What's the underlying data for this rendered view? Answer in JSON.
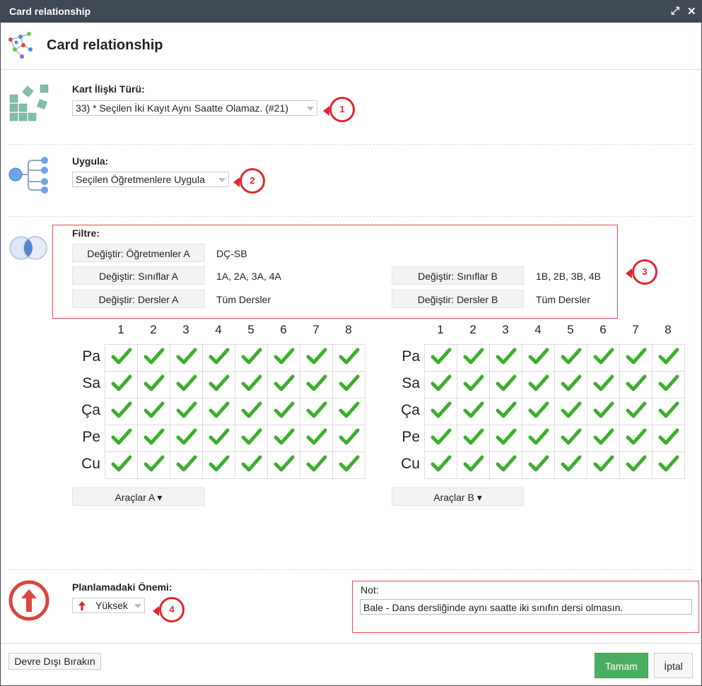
{
  "window": {
    "title": "Card relationship"
  },
  "header": {
    "title": "Card relationship"
  },
  "relation": {
    "label": "Kart İlişki Türü:",
    "value": "33) * Seçilen İki Kayıt Aynı Saatte Olamaz. (#21)",
    "badge": "1"
  },
  "apply": {
    "label": "Uygula:",
    "value": "Seçilen Öğretmenlere Uygula",
    "badge": "2"
  },
  "filter": {
    "label": "Filtre:",
    "badge": "3",
    "teachers_a_btn": "Değiştir: Öğretmenler A",
    "teachers_a_val": "DÇ-SB",
    "classes_a_btn": "Değiştir: Sınıflar A",
    "classes_a_val": "1A, 2A, 3A, 4A",
    "classes_b_btn": "Değiştir: Sınıflar B",
    "classes_b_val": "1B, 2B, 3B, 4B",
    "lessons_a_btn": "Değiştir: Dersler A",
    "lessons_a_val": "Tüm Dersler",
    "lessons_b_btn": "Değiştir: Dersler B",
    "lessons_b_val": "Tüm Dersler"
  },
  "grid": {
    "periods": [
      "1",
      "2",
      "3",
      "4",
      "5",
      "6",
      "7",
      "8"
    ],
    "days": [
      "Pa",
      "Sa",
      "Ça",
      "Pe",
      "Cu"
    ],
    "check_color": "#3cae2c"
  },
  "tools": {
    "a_label": "Araçlar A ▾",
    "b_label": "Araçlar B ▾"
  },
  "importance": {
    "label": "Planlamadaki Önemi:",
    "value": "Yüksek",
    "badge": "4"
  },
  "note": {
    "label": "Not:",
    "value": "Bale - Dans dersliğinde aynı saatte iki sınıfın dersi olmasın."
  },
  "footer": {
    "disable_label": "Devre Dışı Bırakın",
    "ok_label": "Tamam",
    "cancel_label": "İptal"
  },
  "colors": {
    "titlebar": "#3f4a56",
    "ok_button": "#4cae60",
    "badge_red": "#e0262e"
  }
}
